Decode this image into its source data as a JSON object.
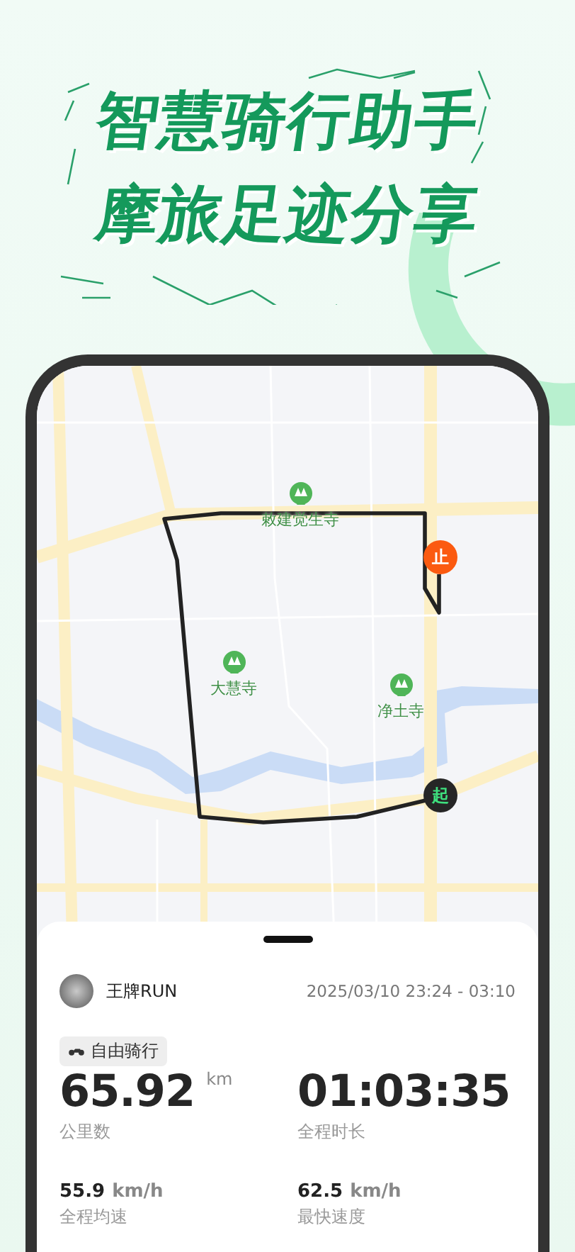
{
  "headline": {
    "lines": [
      "智慧骑行助手",
      "摩旅足迹分享"
    ]
  },
  "map": {
    "pois": [
      {
        "name": "敕建觉生寺"
      },
      {
        "name": "大慧寺"
      },
      {
        "name": "净土寺"
      }
    ],
    "markers": [
      {
        "kind": "end",
        "label": "止"
      },
      {
        "kind": "start",
        "label": "起"
      }
    ]
  },
  "ride": {
    "user": {
      "name": "王牌RUN"
    },
    "time_range": "2025/03/10 23:24 - 03:10",
    "mode_tag": "自由骑行",
    "primary_stats": [
      {
        "value": "65.92",
        "unit": "km",
        "label": "公里数"
      },
      {
        "value": "01:03:35",
        "label": "全程时长"
      }
    ],
    "secondary_stats": [
      {
        "value": "55.9",
        "unit": "km/h",
        "label": "全程均速"
      },
      {
        "value": "62.5",
        "unit": "km/h",
        "label": "最快速度"
      }
    ]
  }
}
